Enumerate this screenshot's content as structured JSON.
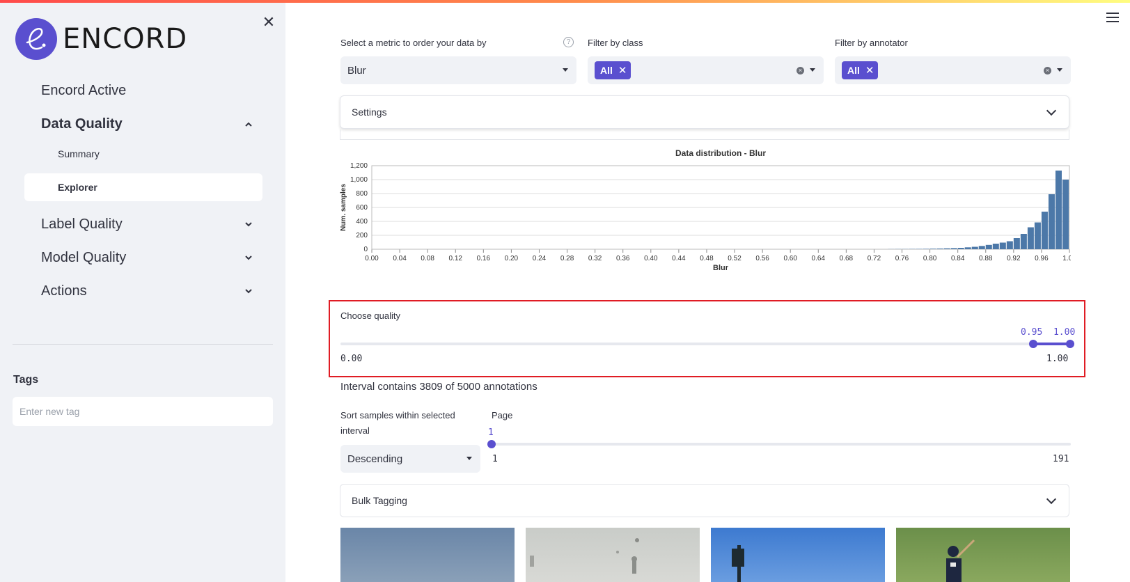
{
  "sidebar": {
    "logo_text": "ENCORD",
    "nav": [
      {
        "label": "Encord Active",
        "expanded": null
      },
      {
        "label": "Data Quality",
        "expanded": true
      },
      {
        "label": "Label Quality",
        "expanded": false
      },
      {
        "label": "Model Quality",
        "expanded": false
      },
      {
        "label": "Actions",
        "expanded": false
      }
    ],
    "sub_items": [
      "Summary",
      "Explorer"
    ],
    "active_sub": "Explorer",
    "tags_title": "Tags",
    "tag_placeholder": "Enter new tag"
  },
  "filters": {
    "metric_label": "Select a metric to order your data by",
    "metric_value": "Blur",
    "class_label": "Filter by class",
    "class_chip": "All",
    "annotator_label": "Filter by annotator",
    "annotator_chip": "All"
  },
  "settings_label": "Settings",
  "chart_data": {
    "type": "bar",
    "title": "Data distribution - Blur",
    "xlabel": "Blur",
    "ylabel": "Num. samples",
    "xlim": [
      0,
      1
    ],
    "ylim": [
      0,
      1200
    ],
    "yticks": [
      "0",
      "200",
      "400",
      "600",
      "800",
      "1,000",
      "1,200"
    ],
    "xticks": [
      "0.00",
      "0.04",
      "0.08",
      "0.12",
      "0.16",
      "0.20",
      "0.24",
      "0.28",
      "0.32",
      "0.36",
      "0.40",
      "0.44",
      "0.48",
      "0.52",
      "0.56",
      "0.60",
      "0.64",
      "0.68",
      "0.72",
      "0.76",
      "0.80",
      "0.84",
      "0.88",
      "0.92",
      "0.96",
      "1.00"
    ],
    "bin_width": 0.01,
    "bins": [
      {
        "x": 0.74,
        "v": 2
      },
      {
        "x": 0.75,
        "v": 3
      },
      {
        "x": 0.76,
        "v": 3
      },
      {
        "x": 0.77,
        "v": 4
      },
      {
        "x": 0.78,
        "v": 5
      },
      {
        "x": 0.79,
        "v": 6
      },
      {
        "x": 0.8,
        "v": 8
      },
      {
        "x": 0.81,
        "v": 10
      },
      {
        "x": 0.82,
        "v": 13
      },
      {
        "x": 0.83,
        "v": 16
      },
      {
        "x": 0.84,
        "v": 20
      },
      {
        "x": 0.85,
        "v": 27
      },
      {
        "x": 0.86,
        "v": 35
      },
      {
        "x": 0.87,
        "v": 47
      },
      {
        "x": 0.88,
        "v": 62
      },
      {
        "x": 0.89,
        "v": 80
      },
      {
        "x": 0.9,
        "v": 95
      },
      {
        "x": 0.91,
        "v": 115
      },
      {
        "x": 0.92,
        "v": 160
      },
      {
        "x": 0.93,
        "v": 220
      },
      {
        "x": 0.94,
        "v": 315
      },
      {
        "x": 0.95,
        "v": 385
      },
      {
        "x": 0.96,
        "v": 540
      },
      {
        "x": 0.97,
        "v": 790
      },
      {
        "x": 0.98,
        "v": 1130
      },
      {
        "x": 0.99,
        "v": 1000
      }
    ],
    "bar_color": "#4c78a8"
  },
  "quality": {
    "label": "Choose quality",
    "min": "0.00",
    "max": "1.00",
    "value_low": 0.95,
    "value_high": 1.0,
    "value_text": "0.95  1.00"
  },
  "interval_text": "Interval contains 3809 of 5000 annotations",
  "sort": {
    "label": "Sort samples within selected interval",
    "value": "Descending"
  },
  "page": {
    "label": "Page",
    "current": "1",
    "min": "1",
    "max": "191"
  },
  "bulk_label": "Bulk Tagging",
  "colors": {
    "accent": "#5a4fcf",
    "highlight_border": "#e01c24"
  }
}
